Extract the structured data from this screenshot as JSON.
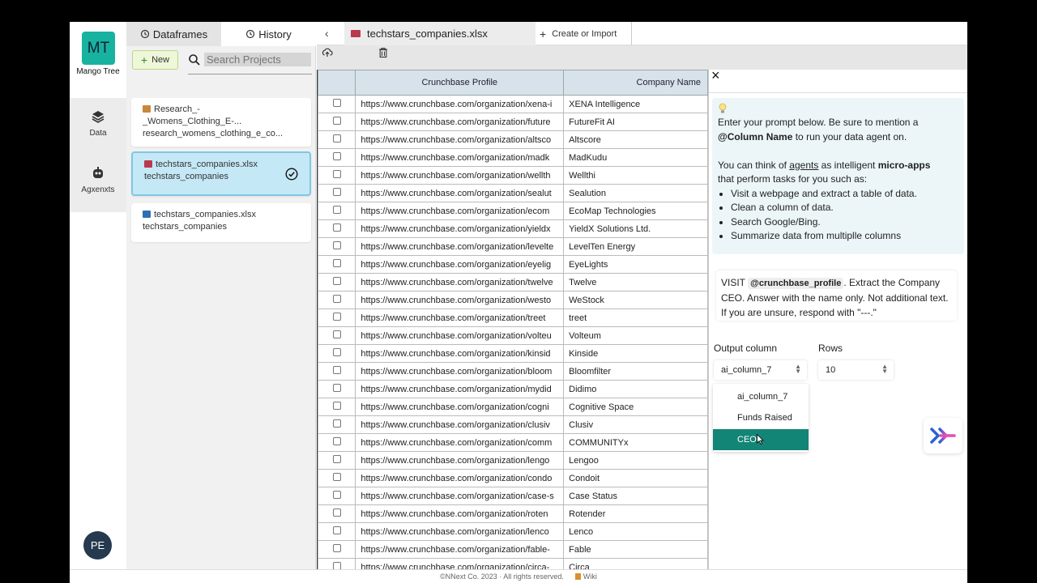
{
  "brand": {
    "initials": "MT",
    "name": "Mango Tree",
    "logo_color": "#17b3a0"
  },
  "rail": {
    "items": [
      {
        "label": "Data",
        "icon": "layers-icon"
      },
      {
        "label": "Agxenxts",
        "icon": "robot-icon"
      }
    ],
    "user_initials": "PE"
  },
  "panel": {
    "tabs": [
      {
        "label": "Dataframes",
        "icon": "history-icon"
      },
      {
        "label": "History",
        "icon": "history-icon"
      }
    ],
    "new_label": "New",
    "search_placeholder": "Search Projects",
    "projects": [
      {
        "line1": "Research_-",
        "line2": "_Womens_Clothing_E-...",
        "line3": "research_womens_clothing_e_co...",
        "icon": "box-icon"
      },
      {
        "line1": "techstars_companies.xlsx",
        "line2": "techstars_companies",
        "icon": "spreadsheet-icon",
        "selected": true
      },
      {
        "line1": "techstars_companies.xlsx",
        "line2": "techstars_companies",
        "icon": "book-icon"
      }
    ]
  },
  "main": {
    "file_tab": "techstars_companies.xlsx",
    "create_tab": "Create or Import",
    "columns": [
      "Crunchbase Profile",
      "Company Name"
    ],
    "rows": [
      [
        "https://www.crunchbase.com/organization/xena-i",
        "XENA Intelligence"
      ],
      [
        "https://www.crunchbase.com/organization/future",
        "FutureFit AI"
      ],
      [
        "https://www.crunchbase.com/organization/altsco",
        "Altscore"
      ],
      [
        "https://www.crunchbase.com/organization/madk",
        "MadKudu"
      ],
      [
        "https://www.crunchbase.com/organization/wellth",
        "Wellthi"
      ],
      [
        "https://www.crunchbase.com/organization/sealut",
        "Sealution"
      ],
      [
        "https://www.crunchbase.com/organization/ecom",
        "EcoMap Technologies"
      ],
      [
        "https://www.crunchbase.com/organization/yieldx",
        "YieldX Solutions Ltd."
      ],
      [
        "https://www.crunchbase.com/organization/levelte",
        "LevelTen Energy"
      ],
      [
        "https://www.crunchbase.com/organization/eyelig",
        "EyeLights"
      ],
      [
        "https://www.crunchbase.com/organization/twelve",
        "Twelve"
      ],
      [
        "https://www.crunchbase.com/organization/westo",
        "WeStock"
      ],
      [
        "https://www.crunchbase.com/organization/treet",
        "treet"
      ],
      [
        "https://www.crunchbase.com/organization/volteu",
        "Volteum"
      ],
      [
        "https://www.crunchbase.com/organization/kinsid",
        "Kinside"
      ],
      [
        "https://www.crunchbase.com/organization/bloom",
        "Bloomfilter"
      ],
      [
        "https://www.crunchbase.com/organization/mydid",
        "Didimo"
      ],
      [
        "https://www.crunchbase.com/organization/cogni",
        "Cognitive Space"
      ],
      [
        "https://www.crunchbase.com/organization/clusiv",
        "Clusiv"
      ],
      [
        "https://www.crunchbase.com/organization/comm",
        "COMMUNITYx"
      ],
      [
        "https://www.crunchbase.com/organization/lengo",
        "Lengoo"
      ],
      [
        "https://www.crunchbase.com/organization/condo",
        "Condoit"
      ],
      [
        "https://www.crunchbase.com/organization/case-s",
        "Case Status"
      ],
      [
        "https://www.crunchbase.com/organization/roten",
        "Rotender"
      ],
      [
        "https://www.crunchbase.com/organization/lenco",
        "Lenco"
      ],
      [
        "https://www.crunchbase.com/organization/fable-",
        "Fable"
      ],
      [
        "https://www.crunchbase.com/organization/circa-",
        "Circa"
      ]
    ]
  },
  "agent": {
    "info": {
      "line1": "Enter your prompt below. Be sure to mention a",
      "column_name": "@Column Name",
      "line2_rest": " to run your data agent on.",
      "p2_a": "You can think of ",
      "agents_link": "agents",
      "p2_b": " as intelligent ",
      "micro_apps": "micro-apps",
      "p2_c": "that perform tasks for you such as:",
      "bullets": [
        "Visit a webpage and extract a table of data.",
        "Clean a column of data.",
        "Search Google/Bing.",
        "Summarize data from multiplle columns"
      ]
    },
    "prompt": {
      "prefix": "VISIT ",
      "chip": "@crunchbase_profile",
      "rest": ". Extract the Company CEO. Answer with the name only. Not additional text. If you are unsure, respond with \"---.\""
    },
    "output_label": "Output column",
    "output_value": "ai_column_7",
    "rows_label": "Rows",
    "rows_value": "10",
    "options": [
      "ai_column_7",
      "Funds Raised",
      "CEO"
    ],
    "active_option": "CEO",
    "accent": "#138576"
  },
  "footer": {
    "copyright": "©NNext Co. 2023 · All rights reserved.",
    "wiki": "Wiki"
  }
}
